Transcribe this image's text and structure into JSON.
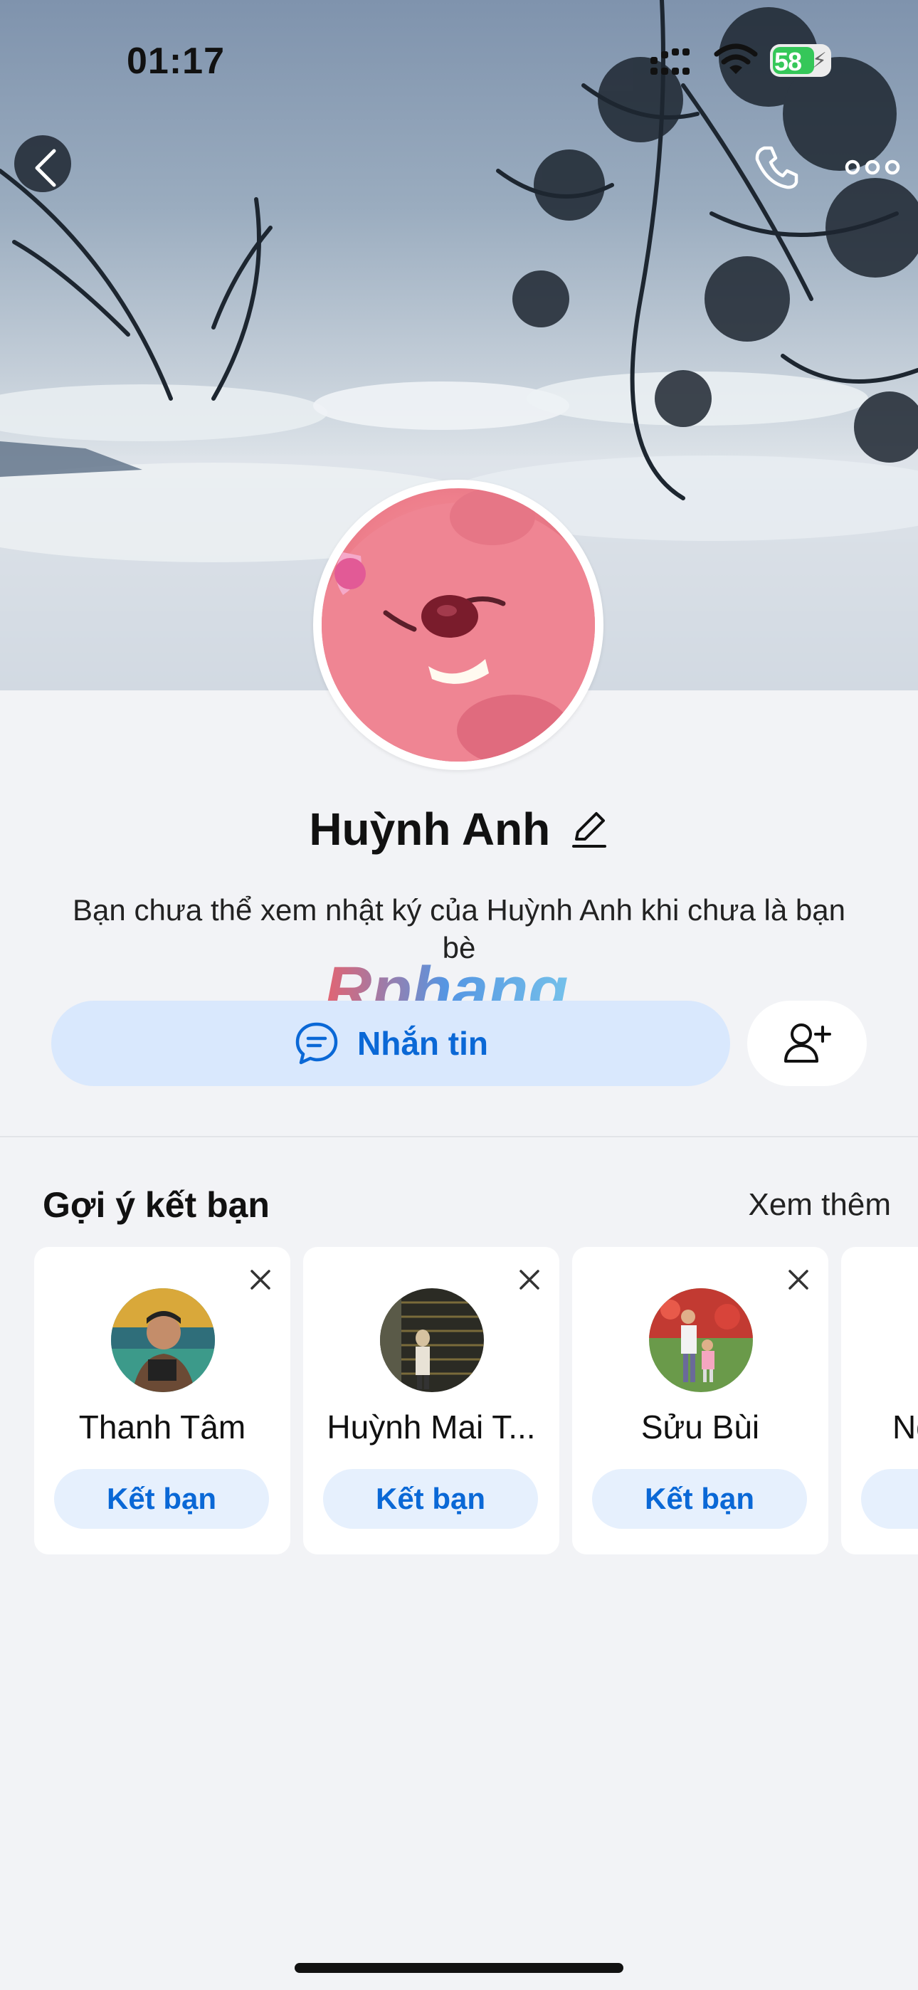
{
  "status_bar": {
    "time": "01:17",
    "battery_percent": "58",
    "battery_icon": "battery-charging-icon",
    "signal_icon": "cellular-signal-icon",
    "wifi_icon": "wifi-icon"
  },
  "header": {
    "back_icon": "chevron-left-icon",
    "call_icon": "phone-icon",
    "more_icon": "more-horizontal-icon"
  },
  "profile": {
    "name": "Huỳnh Anh",
    "edit_icon": "pencil-icon",
    "description": "Bạn chưa thể xem nhật ký của Huỳnh Anh khi chưa là bạn bè",
    "watermark": "Rphang"
  },
  "actions": {
    "message_label": "Nhắn tin",
    "message_icon": "chat-bubble-icon",
    "add_friend_icon": "add-user-icon"
  },
  "suggestions": {
    "title": "Gợi ý kết bạn",
    "see_more": "Xem thêm",
    "items": [
      {
        "name": "Thanh Tâm",
        "button": "Kết bạn"
      },
      {
        "name": "Huỳnh Mai T...",
        "button": "Kết bạn"
      },
      {
        "name": "Sửu Bùi",
        "button": "Kết bạn"
      },
      {
        "name": "Ng",
        "button": "Kết bạn"
      }
    ]
  },
  "colors": {
    "accent": "#0a68d6",
    "message_button_bg": "#d9e8fd",
    "page_bg": "#f2f3f6",
    "battery_green": "#35c759"
  }
}
